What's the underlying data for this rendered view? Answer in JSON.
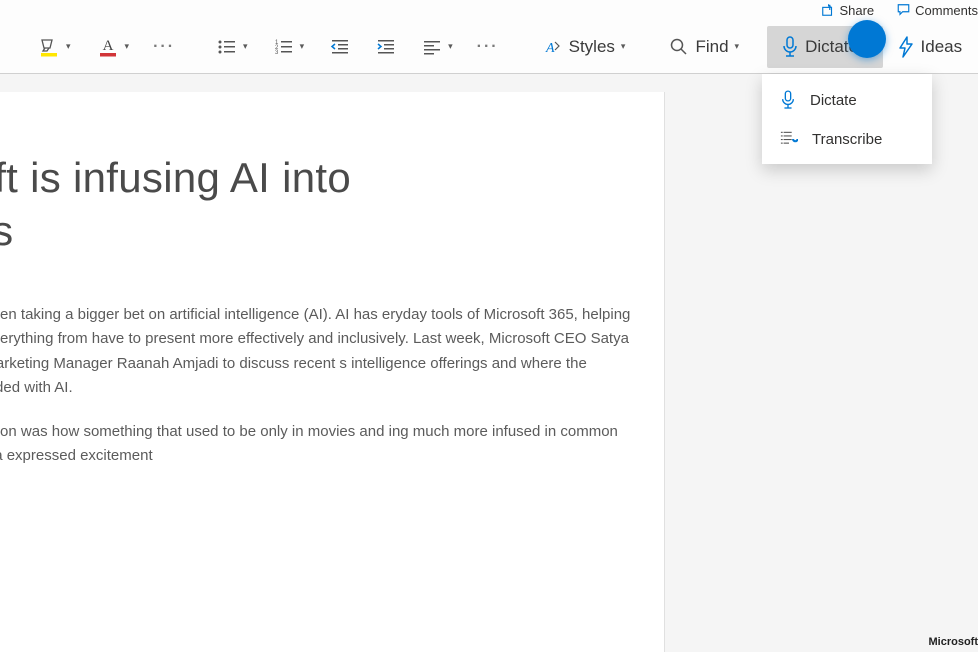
{
  "topbar": {
    "share_label": "Share",
    "comments_label": "Comments"
  },
  "ribbon": {
    "highlight_color": "#ffe600",
    "font_color": "#d13438",
    "styles_label": "Styles",
    "find_label": "Find",
    "dictate_label": "Dictate",
    "ideas_label": "Ideas"
  },
  "dropdown": {
    "items": [
      {
        "label": "Dictate"
      },
      {
        "label": "Transcribe"
      }
    ]
  },
  "document": {
    "title_line1": "crosoft is infusing AI into",
    "title_line2": "y tools",
    "para1": "Microsoft has been taking a bigger bet on artificial intelligence (AI). AI has eryday tools of Microsoft 365, helping customers do everything from have to present more effectively and inclusively. Last week, Microsoft CEO Satya enior Product Marketing Manager Raanah Amjadi to discuss recent s intelligence offerings and where the company is headed with AI.",
    "para2": "of the conversation was how something that used to be only in movies and ing much more infused in common workflows. Satya expressed excitement"
  },
  "attribution": "Microsoft"
}
